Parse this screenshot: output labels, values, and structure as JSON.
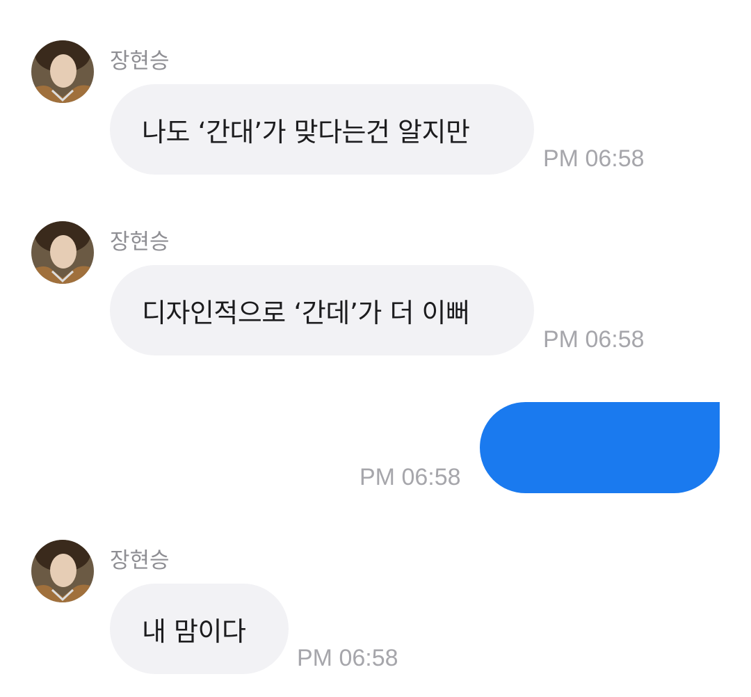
{
  "messages": [
    {
      "sender": "장현승",
      "text": "나도 ‘간대’가 맞다는건 알지만",
      "time": "PM 06:58"
    },
    {
      "sender": "장현승",
      "text": "디자인적으로 ‘간데’가 더 이뻐",
      "time": "PM 06:58"
    },
    {
      "sender": "",
      "text": "",
      "time": "PM 06:58"
    },
    {
      "sender": "장현승",
      "text": "내 맘이다",
      "time": "PM 06:58"
    }
  ],
  "colors": {
    "incoming_bubble": "#f2f2f5",
    "outgoing_bubble": "#1a7aef",
    "sender_name": "#8e8e93",
    "timestamp": "#a6a6ab"
  },
  "icons": {
    "avatar": "profile-photo"
  }
}
